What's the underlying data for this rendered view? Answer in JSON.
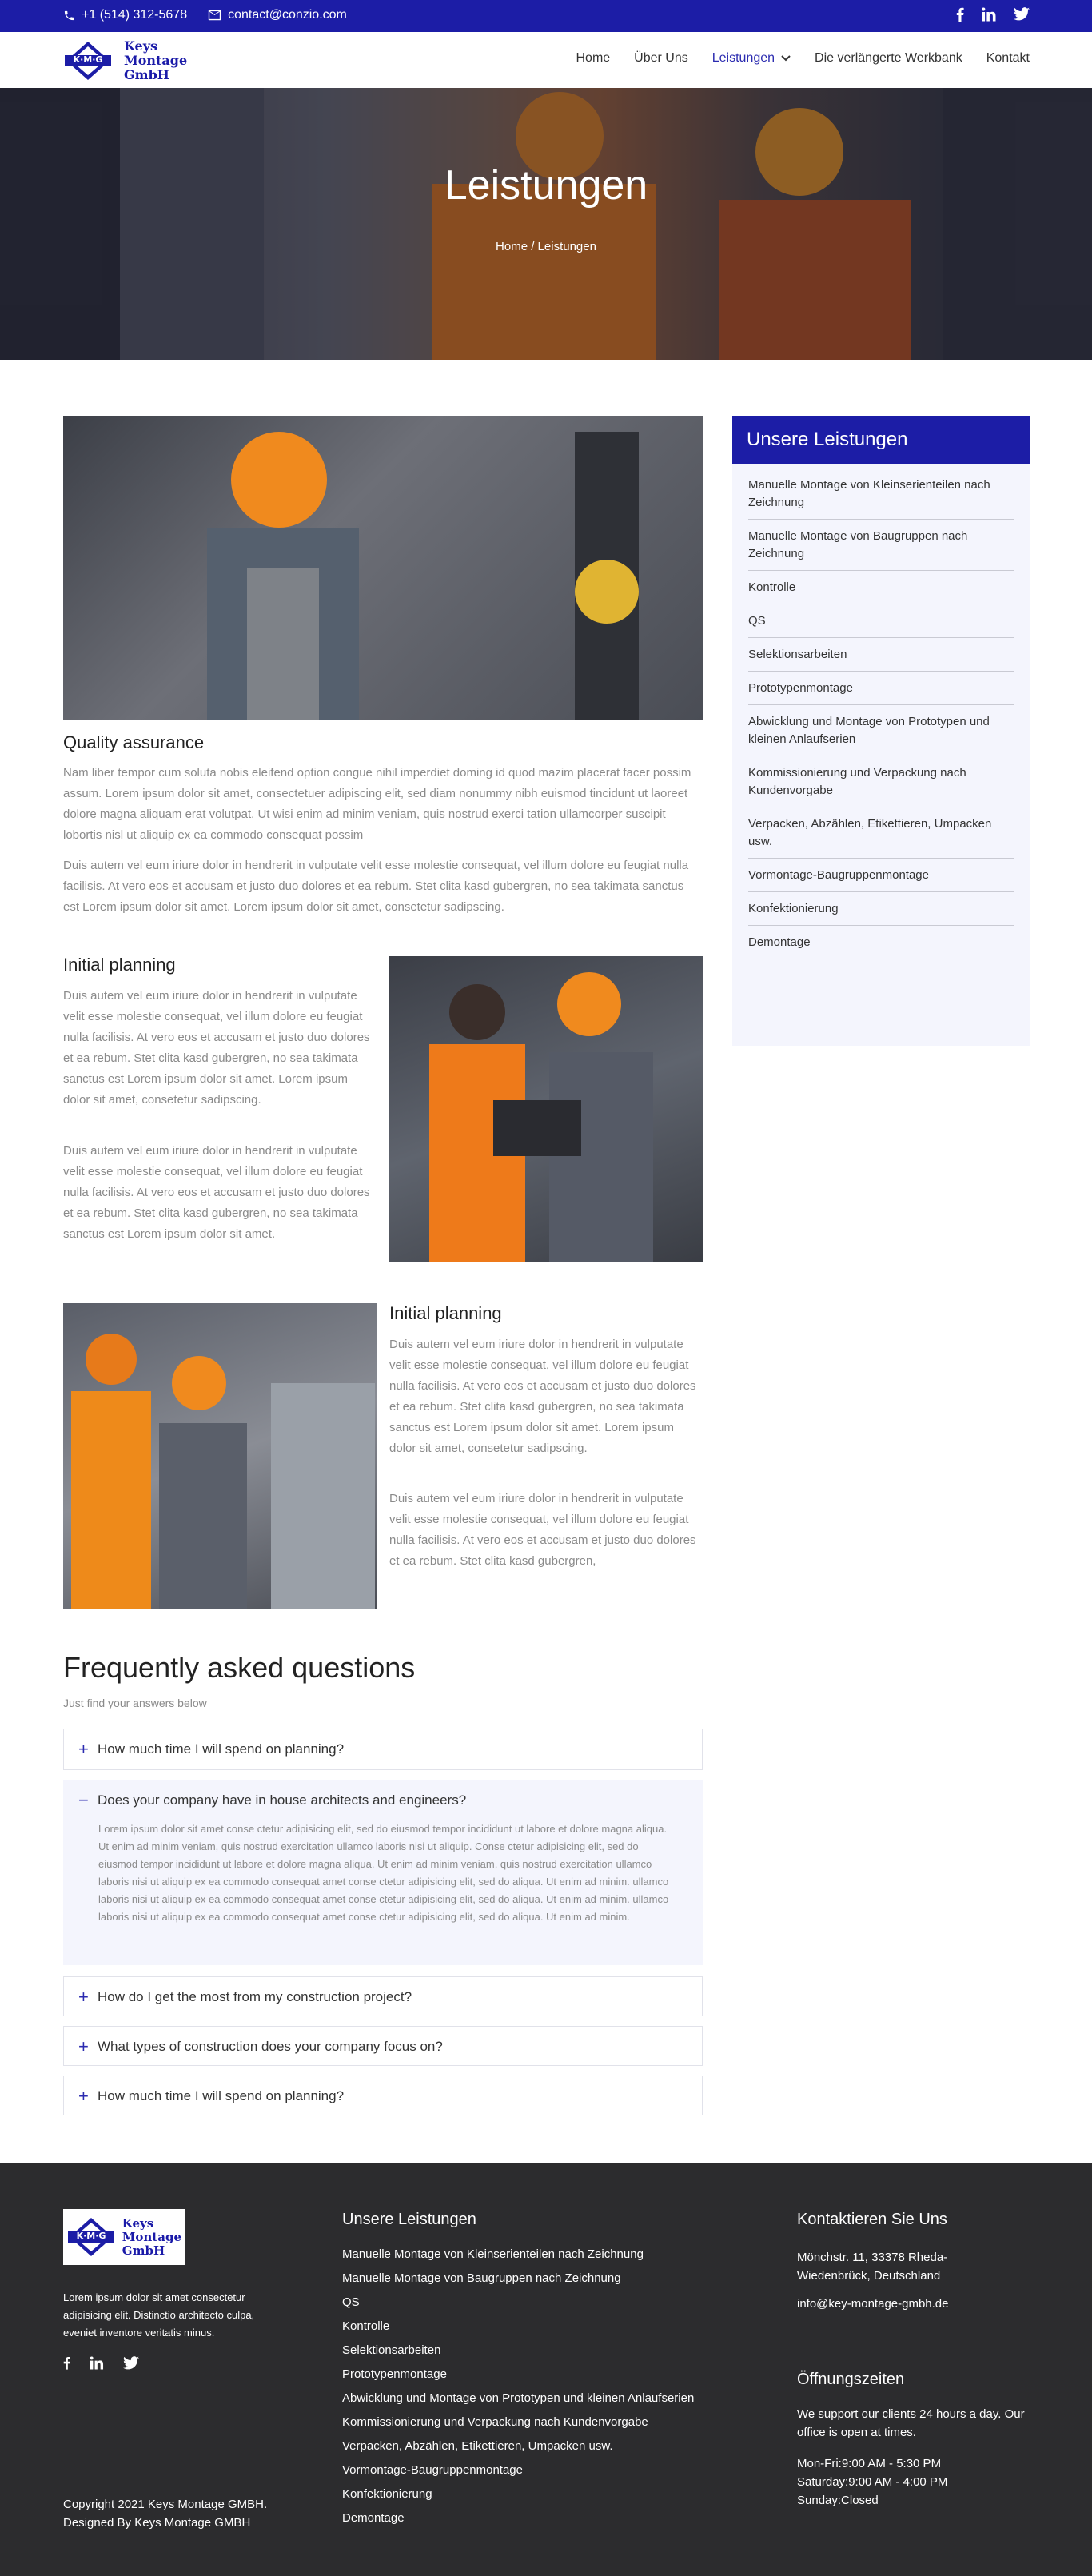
{
  "topbar": {
    "phone": "+1 (514) 312-5678",
    "email": "contact@conzio.com"
  },
  "logo": {
    "badge": "K·M·G",
    "line1": "Keys",
    "line2": "Montage",
    "line3": "GmbH"
  },
  "nav": [
    "Home",
    "Über Uns",
    "Leistungen",
    "Die verlängerte Werkbank",
    "Kontakt"
  ],
  "hero": {
    "title": "Leistungen",
    "breadcrumb": "Home / Leistungen"
  },
  "quality": {
    "title": "Quality assurance",
    "p1": "Nam liber tempor cum soluta nobis eleifend option congue nihil imperdiet doming id quod mazim placerat facer possim assum. Lorem ipsum dolor sit amet, consectetuer adipiscing elit, sed diam nonummy nibh euismod tincidunt ut laoreet dolore magna aliquam erat volutpat. Ut wisi enim ad minim veniam, quis nostrud exerci tation ullamcorper suscipit lobortis nisl ut aliquip ex ea commodo consequat possim",
    "p2": "Duis autem vel eum iriure dolor in hendrerit in vulputate velit esse molestie consequat, vel illum dolore eu feugiat nulla facilisis. At vero eos et accusam et justo duo dolores et ea rebum. Stet clita kasd gubergren, no sea takimata sanctus est Lorem ipsum dolor sit amet. Lorem ipsum dolor sit amet, consetetur sadipscing."
  },
  "planning1": {
    "title": "Initial planning",
    "p1": "Duis autem vel eum iriure dolor in hendrerit in vulputate velit esse molestie consequat, vel illum dolore eu feugiat nulla facilisis. At vero eos et accusam et justo duo dolores et ea rebum. Stet clita kasd gubergren, no sea takimata sanctus est Lorem ipsum dolor sit amet. Lorem ipsum dolor sit amet, consetetur sadipscing.",
    "p2": "Duis autem vel eum iriure dolor in hendrerit in vulputate velit esse molestie consequat, vel illum dolore eu feugiat nulla facilisis. At vero eos et accusam et justo duo dolores et ea rebum. Stet clita kasd gubergren, no sea takimata sanctus est Lorem ipsum dolor sit amet."
  },
  "planning2": {
    "title": "Initial planning",
    "p1": "Duis autem vel eum iriure dolor in hendrerit in vulputate velit esse molestie consequat, vel illum dolore eu feugiat nulla facilisis. At vero eos et accusam et justo duo dolores et ea rebum. Stet clita kasd gubergren, no sea takimata sanctus est Lorem ipsum dolor sit amet. Lorem ipsum dolor sit amet, consetetur sadipscing.",
    "p2": "Duis autem vel eum iriure dolor in hendrerit in vulputate velit esse molestie consequat, vel illum dolore eu feugiat nulla facilisis. At vero eos et accusam et justo duo dolores et ea rebum. Stet clita kasd gubergren,"
  },
  "sidebar": {
    "title": "Unsere Leistungen",
    "items": [
      "Manuelle Montage von Kleinserienteilen nach Zeichnung",
      "Manuelle Montage von Baugruppen nach Zeichnung",
      "Kontrolle",
      "QS",
      "Selektionsarbeiten",
      "Prototypenmontage",
      "Abwicklung und Montage von Prototypen und kleinen Anlaufserien",
      "Kommissionierung und Verpackung nach Kundenvorgabe",
      "Verpacken, Abzählen, Etikettieren, Umpacken usw.",
      "Vormontage-Baugruppenmontage",
      "Konfektionierung",
      "Demontage"
    ]
  },
  "faq": {
    "title": "Frequently asked questions",
    "subtitle": "Just find your answers below",
    "items": [
      {
        "q": "How much time I will spend on planning?",
        "sign": "+"
      },
      {
        "q": "Does your company have in house architects and engineers?",
        "sign": "−",
        "a": "Lorem ipsum dolor sit amet conse ctetur adipisicing elit, sed do eiusmod tempor incididunt ut labore et dolore magna aliqua. Ut enim ad minim veniam, quis nostrud exercitation ullamco laboris nisi ut aliquip. Conse ctetur adipisicing elit, sed do eiusmod tempor incididunt ut labore et dolore magna aliqua. Ut enim ad minim veniam, quis nostrud exercitation ullamco laboris nisi ut aliquip ex ea commodo consequat amet conse ctetur adipisicing elit, sed do aliqua. Ut enim ad minim.  ullamco laboris nisi ut aliquip ex ea commodo consequat amet conse ctetur adipisicing elit, sed do aliqua. Ut enim ad minim.  ullamco laboris nisi ut aliquip ex ea commodo consequat amet conse ctetur adipisicing elit, sed do aliqua. Ut enim ad minim."
      },
      {
        "q": "How do I get the most from my construction project?",
        "sign": "+"
      },
      {
        "q": "What types of construction does your company focus on?",
        "sign": "+"
      },
      {
        "q": "How much time I will spend on planning?",
        "sign": "+"
      }
    ]
  },
  "footer": {
    "text": "Lorem ipsum dolor sit amet consectetur adipisicing elit. Distinctio architecto culpa, eveniet inventore veritatis minus.",
    "copyright1": "Copyright 2021 Keys Montage GMBH.",
    "copyright2": "Designed By Keys Montage GMBH",
    "services_title": "Unsere Leistungen",
    "services": [
      "Manuelle Montage von Kleinserienteilen nach Zeichnung",
      "Manuelle Montage von Baugruppen nach Zeichnung",
      "QS",
      "Kontrolle",
      "Selektionsarbeiten",
      "Prototypenmontage",
      "Abwicklung und Montage von Prototypen und kleinen Anlaufserien",
      "Kommissionierung und Verpackung nach Kundenvorgabe",
      "Verpacken, Abzählen, Etikettieren, Umpacken usw.",
      "Vormontage-Baugruppenmontage",
      "Konfektionierung",
      "Demontage"
    ],
    "contact_title": "Kontaktieren Sie Uns",
    "address": "Mönchstr. 11, 33378 Rheda-Wiedenbrück, Deutschland",
    "email": "info@key-montage-gmbh.de",
    "hours_title": "Öffnungszeiten",
    "hours_text": "We support our clients 24 hours a day. Our office is open at times.",
    "hours": [
      "Mon-Fri:9:00 AM - 5:30 PM",
      "Saturday:9:00 AM - 4:00 PM",
      "Sunday:Closed"
    ]
  },
  "colors": {
    "brand": "#1c1da6",
    "footer": "#2c2c2e",
    "panel": "#f4f5fd"
  }
}
